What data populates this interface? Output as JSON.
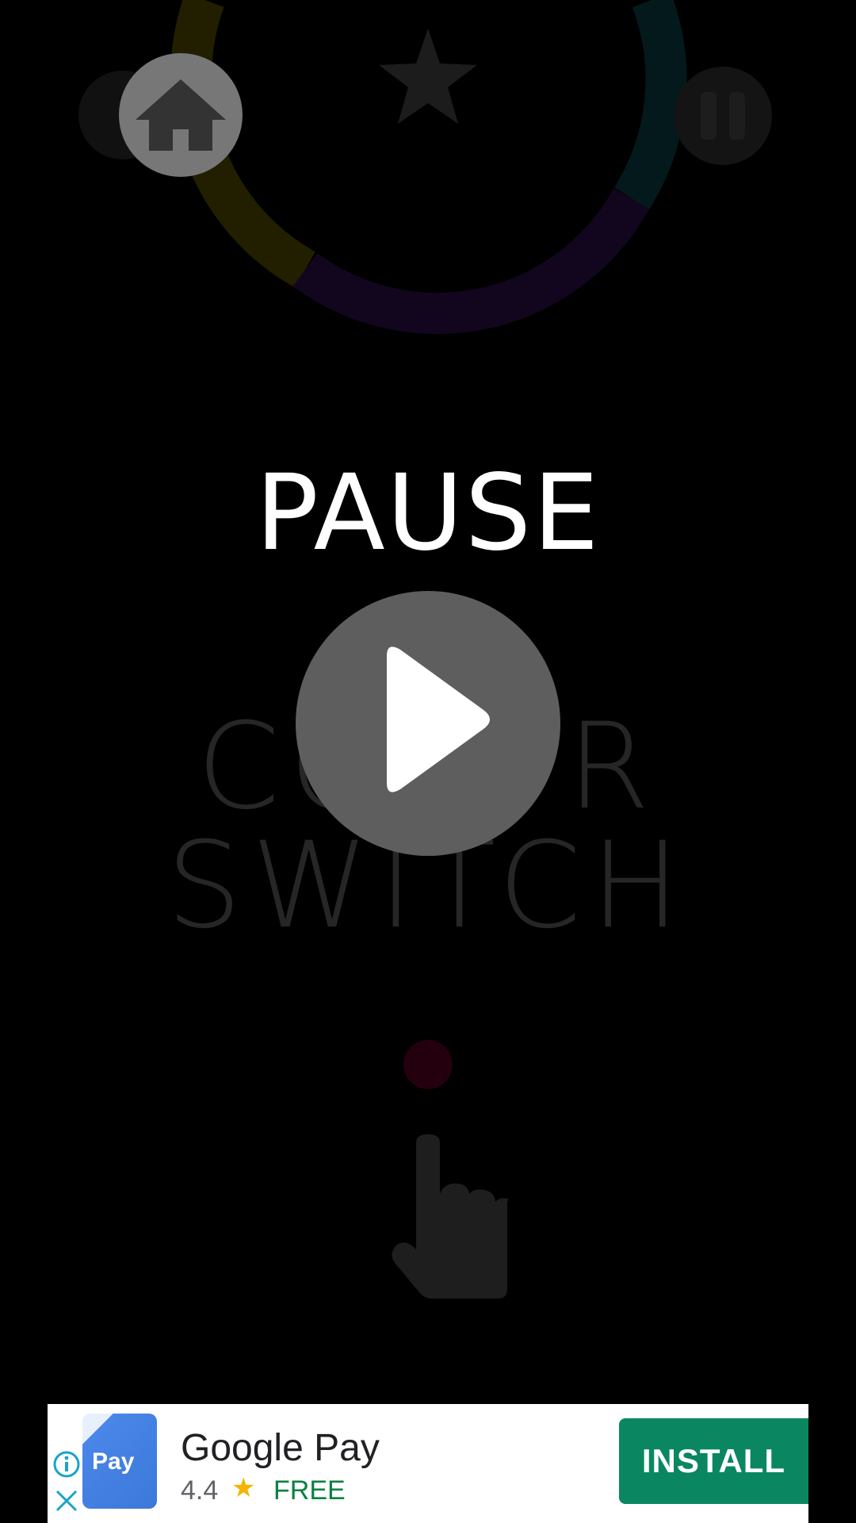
{
  "overlay": {
    "title": "PAUSE"
  },
  "background": {
    "logo_line1": "COLOR",
    "logo_line2": "SWITCH"
  },
  "icons": {
    "home": "home-icon",
    "play": "play-icon",
    "pause": "pause-icon",
    "star": "star-icon",
    "hand": "tap-hand-icon"
  },
  "colors": {
    "ring_yellow": "#2a2500",
    "ring_purple": "#12051f",
    "ring_cyan": "#042022",
    "ring_pink": "#2a0012",
    "dot": "#2a0012",
    "dim_ui": "#1c1c1c",
    "home_button": "#777777",
    "play_button": "#5e5e5e",
    "install_green": "#0a8761"
  },
  "ad": {
    "app_name": "Google Pay",
    "icon_label": "Pay",
    "rating": "4.4",
    "price": "FREE",
    "install_label": "INSTALL"
  }
}
